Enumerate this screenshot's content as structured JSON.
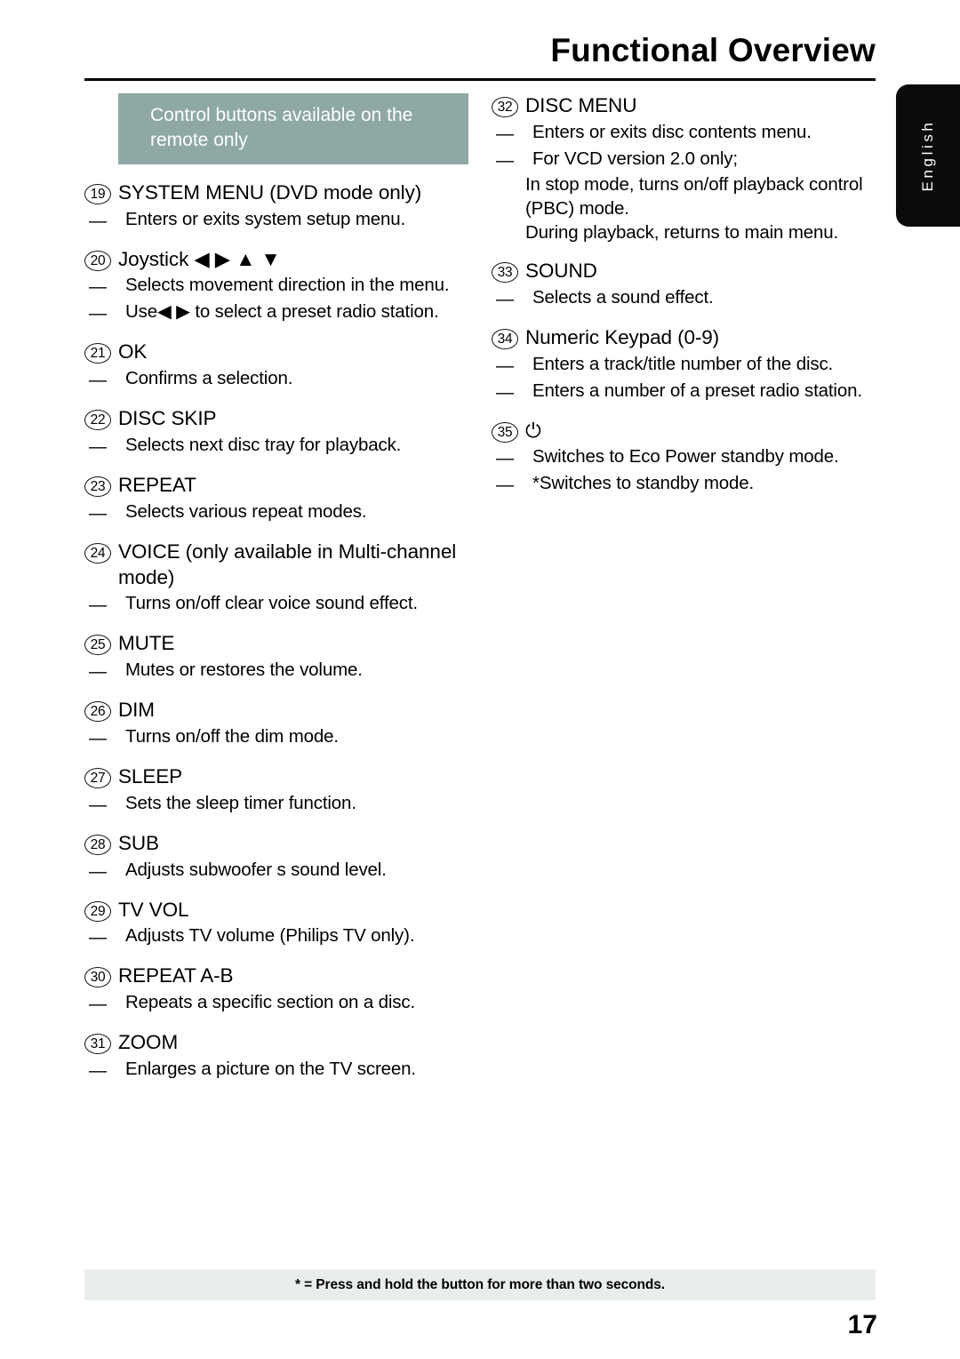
{
  "page": {
    "title": "Functional Overview",
    "number": "17",
    "language_tab": "English",
    "footer_note": "* = Press and hold the button for more than two seconds."
  },
  "callout": {
    "text": "Control buttons available on the remote only"
  },
  "left_column": [
    {
      "num": "19",
      "label": "SYSTEM MENU  (DVD mode only)",
      "bullets": [
        "Enters or exits system setup menu."
      ]
    },
    {
      "num": "20",
      "label": "Joystick ◀ ▶ ▲ ▼",
      "bullets": [
        "Selects movement direction in the menu.",
        "Use◀ ▶ to select a preset radio station."
      ]
    },
    {
      "num": "21",
      "label": "OK",
      "bullets": [
        "Confirms a selection."
      ]
    },
    {
      "num": "22",
      "label": "DISC SKIP",
      "bullets": [
        "Selects next disc tray for playback."
      ]
    },
    {
      "num": "23",
      "label": "REPEAT",
      "bullets": [
        "Selects various repeat modes."
      ]
    },
    {
      "num": "24",
      "label": "VOICE  (only available in Multi-channel mode)",
      "bullets": [
        "Turns on/off clear voice sound effect."
      ]
    },
    {
      "num": "25",
      "label": "MUTE",
      "bullets": [
        "Mutes or restores the volume."
      ]
    },
    {
      "num": "26",
      "label": "DIM",
      "bullets": [
        "Turns on/off the dim mode."
      ]
    },
    {
      "num": "27",
      "label": "SLEEP",
      "bullets": [
        "Sets the sleep timer function."
      ]
    },
    {
      "num": "28",
      "label": "SUB",
      "bullets": [
        "Adjusts subwoofer s sound level."
      ]
    },
    {
      "num": "29",
      "label": "TV VOL",
      "bullets": [
        "Adjusts TV volume (Philips TV only)."
      ]
    },
    {
      "num": "30",
      "label": "REPEAT A-B",
      "bullets": [
        "Repeats a specific section on a disc."
      ]
    },
    {
      "num": "31",
      "label": "ZOOM",
      "bullets": [
        "Enlarges a picture on the TV screen."
      ]
    }
  ],
  "right_column": [
    {
      "num": "32",
      "label": "DISC MENU",
      "bullets": [
        "Enters or exits disc contents menu.",
        "For VCD version 2.0 only;"
      ],
      "continuations": [
        "In stop mode, turns on/off playback control (PBC) mode.",
        "During playback, returns to main menu."
      ]
    },
    {
      "num": "33",
      "label": "SOUND",
      "bullets": [
        "Selects a sound effect."
      ]
    },
    {
      "num": "34",
      "label": "Numeric Keypad (0-9)",
      "bullets": [
        "Enters a track/title number of the disc.",
        "Enters a number of a preset radio station."
      ]
    },
    {
      "num": "35",
      "label": "⏻",
      "bullets": [
        "Switches to Eco Power standby mode.",
        "*Switches to standby mode."
      ]
    }
  ],
  "symbols": {
    "dash": "—"
  },
  "colors": {
    "callout_band": "#8ea8a5",
    "footer_band": "#eaeded",
    "language_tab": "#0b0b0b"
  }
}
